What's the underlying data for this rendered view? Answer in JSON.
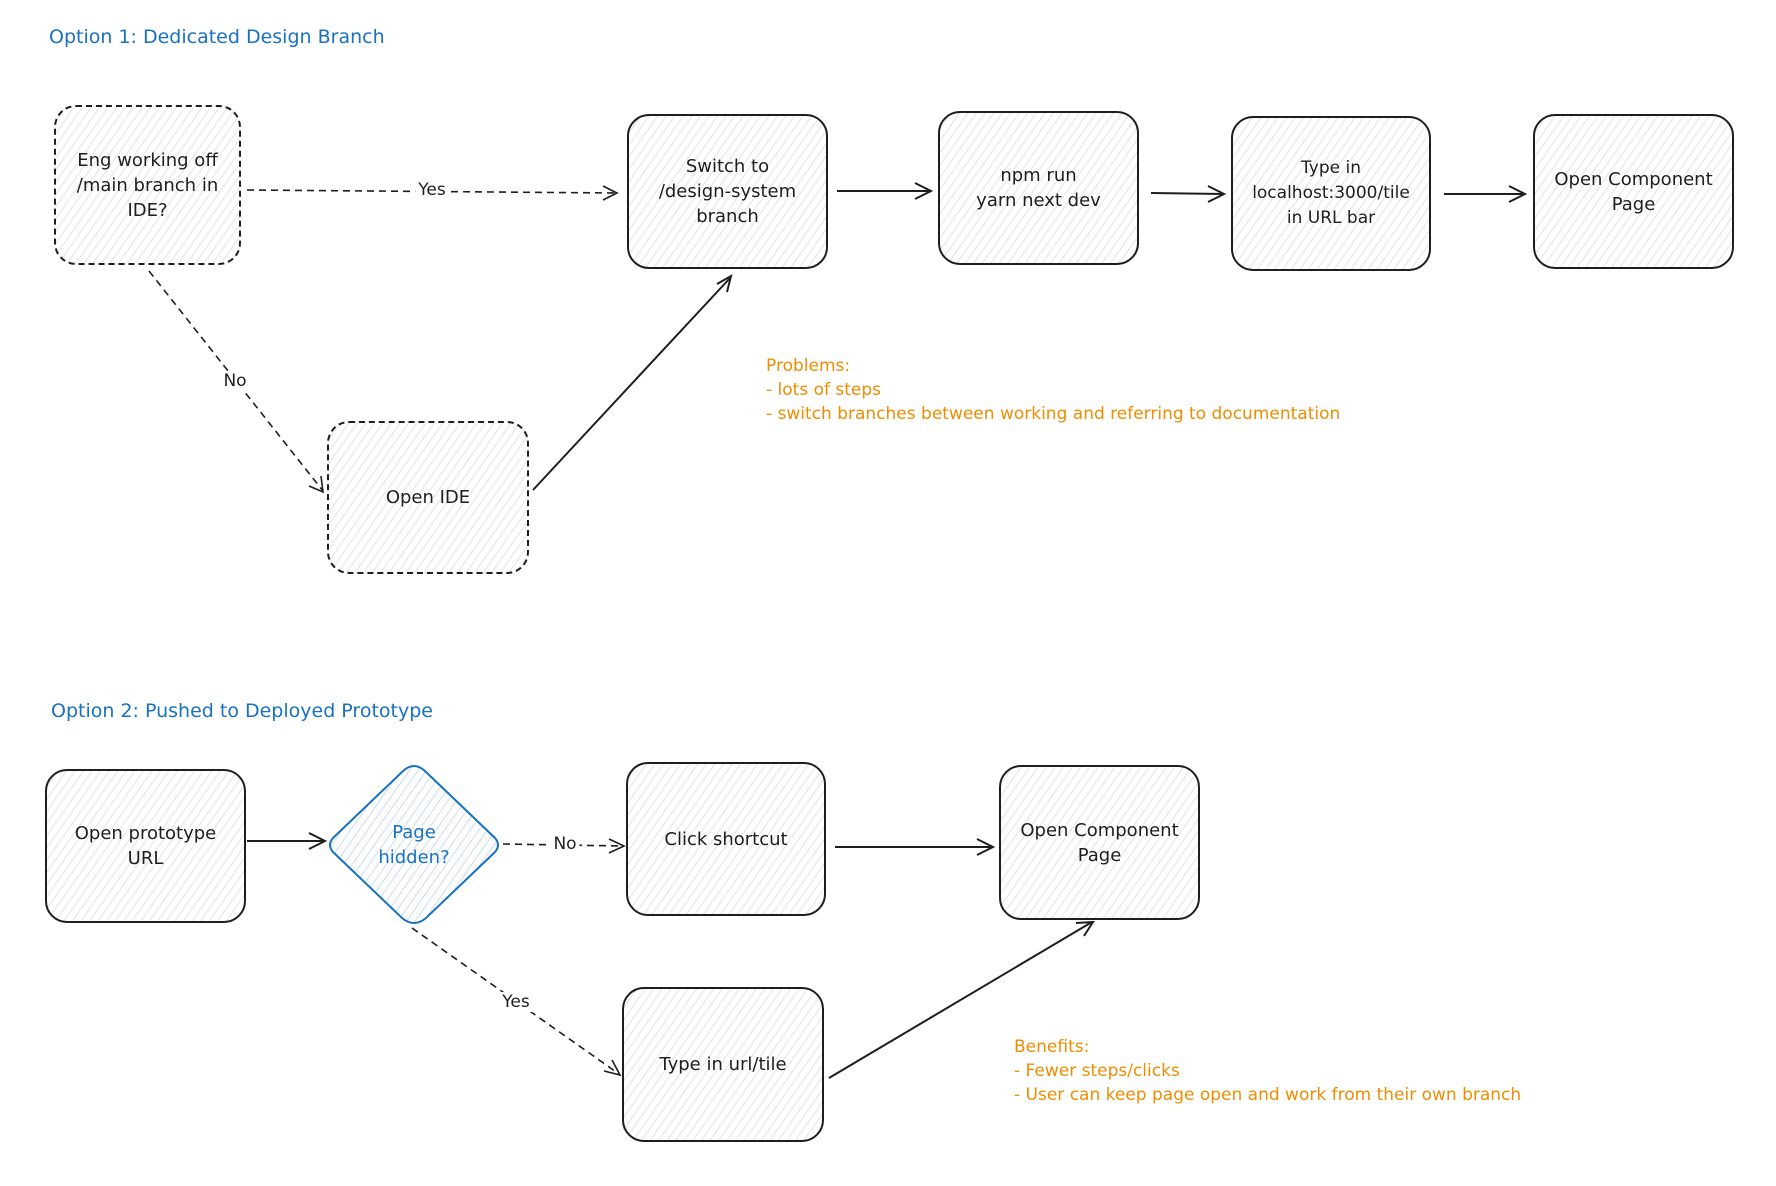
{
  "colors": {
    "ink": "#1e1e1e",
    "title": "#1971c2",
    "note": "#f08c00",
    "decision": "#1971c2"
  },
  "option1": {
    "title": "Option 1:  Dedicated Design Branch",
    "nodes": {
      "eng_question": "Eng working off\n/main branch in\nIDE?",
      "switch_branch": "Switch to\n/design-system\nbranch",
      "npm_run": "npm run\nyarn next dev",
      "type_localhost": "Type in\nlocalhost:3000/tile\nin URL bar",
      "open_component": "Open Component\nPage",
      "open_ide": "Open IDE"
    },
    "edge_labels": {
      "yes": "Yes",
      "no": "No"
    },
    "problems": {
      "heading": "Problems:",
      "items": [
        "- lots of steps",
        "- switch branches between working and referring to documentation"
      ]
    }
  },
  "option2": {
    "title": "Option 2:  Pushed to Deployed Prototype",
    "nodes": {
      "open_prototype": "Open prototype\nURL",
      "page_hidden": "Page\nhidden?",
      "click_shortcut": "Click shortcut",
      "open_component": "Open Component\nPage",
      "type_url": "Type in url/tile"
    },
    "edge_labels": {
      "no": "No",
      "yes": "Yes"
    },
    "benefits": {
      "heading": "Benefits:",
      "items": [
        "- Fewer steps/clicks",
        "- User can keep page open and work from their own branch"
      ]
    }
  }
}
